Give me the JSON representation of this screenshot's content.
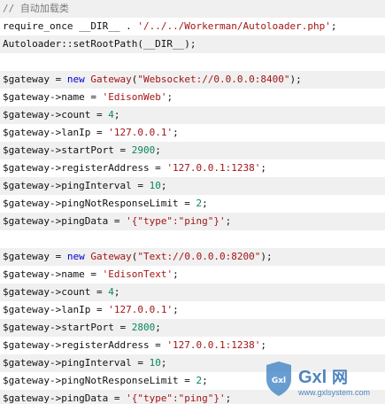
{
  "code": {
    "lines": [
      {
        "text": "// 自动加载类",
        "kind": "comment"
      },
      {
        "text": "require_once __DIR__ . '/../../Workerman/Autoloader.php';",
        "kind": "code"
      },
      {
        "text": "Autoloader::setRootPath(__DIR__);",
        "kind": "code"
      },
      {
        "text": "",
        "kind": "blank"
      },
      {
        "text": "$gateway = new Gateway(\"Websocket://0.0.0.0:8400\");",
        "kind": "code"
      },
      {
        "text": "$gateway->name = 'EdisonWeb';",
        "kind": "code"
      },
      {
        "text": "$gateway->count = 4;",
        "kind": "code"
      },
      {
        "text": "$gateway->lanIp = '127.0.0.1';",
        "kind": "code"
      },
      {
        "text": "$gateway->startPort = 2900;",
        "kind": "code"
      },
      {
        "text": "$gateway->registerAddress = '127.0.0.1:1238';",
        "kind": "code"
      },
      {
        "text": "$gateway->pingInterval = 10;",
        "kind": "code"
      },
      {
        "text": "$gateway->pingNotResponseLimit = 2;",
        "kind": "code"
      },
      {
        "text": "$gateway->pingData = '{\"type\":\"ping\"}';",
        "kind": "code"
      },
      {
        "text": "",
        "kind": "blank"
      },
      {
        "text": "$gateway = new Gateway(\"Text://0.0.0.0:8200\");",
        "kind": "code"
      },
      {
        "text": "$gateway->name = 'EdisonText';",
        "kind": "code"
      },
      {
        "text": "$gateway->count = 4;",
        "kind": "code"
      },
      {
        "text": "$gateway->lanIp = '127.0.0.1';",
        "kind": "code"
      },
      {
        "text": "$gateway->startPort = 2800;",
        "kind": "code"
      },
      {
        "text": "$gateway->registerAddress = '127.0.0.1:1238';",
        "kind": "code"
      },
      {
        "text": "$gateway->pingInterval = 10;",
        "kind": "code"
      },
      {
        "text": "$gateway->pingNotResponseLimit = 2;",
        "kind": "code"
      },
      {
        "text": "$gateway->pingData = '{\"type\":\"ping\"}';",
        "kind": "code"
      }
    ]
  },
  "watermark": {
    "brand": "Gxl",
    "site": "www.gxlsystem.com",
    "colors": {
      "shield": "#3b7fc4",
      "text": "#2f6fb3"
    }
  },
  "colors": {
    "background": "#ffffff",
    "shaded_line": "#f0f0f0",
    "string": "#a31515",
    "comment": "#7a7a7a",
    "number": "#098658",
    "keyword": "#0000cc"
  }
}
